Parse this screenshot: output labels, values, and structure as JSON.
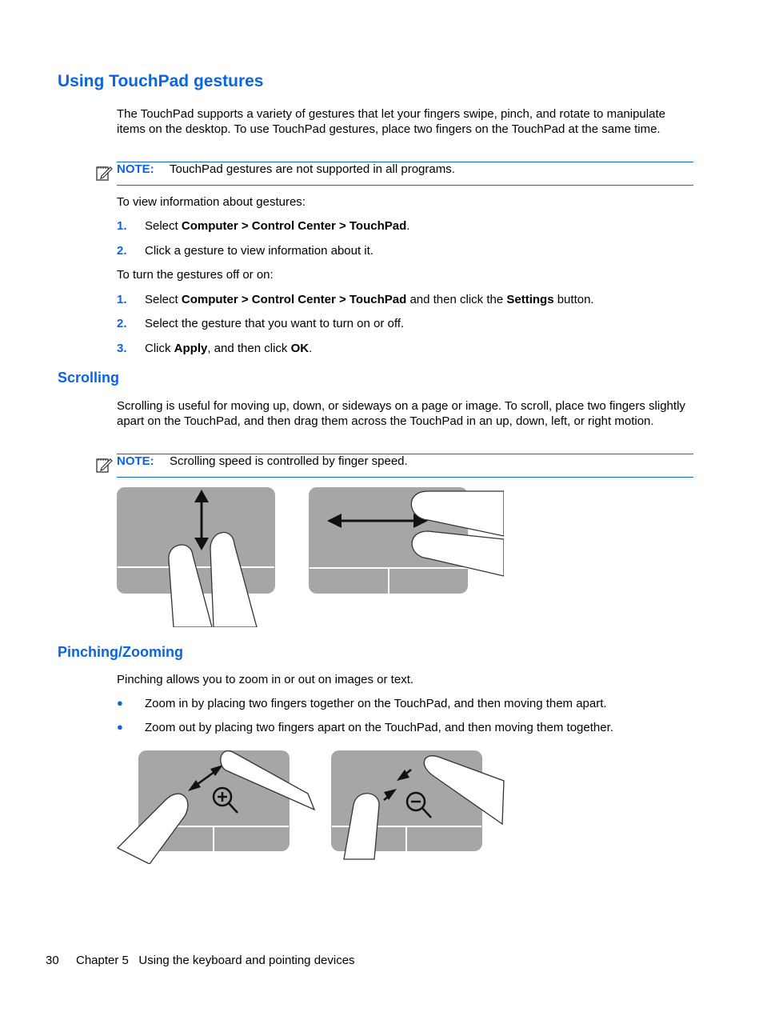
{
  "section": {
    "title": "Using TouchPad gestures",
    "intro": "The TouchPad supports a variety of gestures that let your fingers swipe, pinch, and rotate to manipulate items on the desktop. To use TouchPad gestures, place two fingers on the TouchPad at the same time.",
    "note1": {
      "label": "NOTE:",
      "text": "TouchPad gestures are not supported in all programs."
    },
    "view_info_intro": "To view information about gestures:",
    "view_steps": [
      {
        "num": "1.",
        "pre": "Select ",
        "bold": "Computer > Control Center > TouchPad",
        "post": "."
      },
      {
        "num": "2.",
        "text": "Click a gesture to view information about it."
      }
    ],
    "toggle_intro": "To turn the gestures off or on:",
    "toggle_steps": [
      {
        "num": "1.",
        "pre": "Select ",
        "bold": "Computer > Control Center > TouchPad",
        "mid": " and then click the ",
        "bold2": "Settings",
        "post": " button."
      },
      {
        "num": "2.",
        "text": "Select the gesture that you want to turn on or off."
      },
      {
        "num": "3.",
        "pre": "Click ",
        "bold": "Apply",
        "mid": ", and then click ",
        "bold2": "OK",
        "post": "."
      }
    ]
  },
  "scrolling": {
    "title": "Scrolling",
    "text": "Scrolling is useful for moving up, down, or sideways on a page or image. To scroll, place two fingers slightly apart on the TouchPad, and then drag them across the TouchPad in an up, down, left, or right motion.",
    "note": {
      "label": "NOTE:",
      "text": "Scrolling speed is controlled by finger speed."
    },
    "figures": [
      "vertical-scroll-illustration",
      "horizontal-scroll-illustration"
    ]
  },
  "pinching": {
    "title": "Pinching/Zooming",
    "text": "Pinching allows you to zoom in or out on images or text.",
    "bullets": [
      "Zoom in by placing two fingers together on the TouchPad, and then moving them apart.",
      "Zoom out by placing two fingers apart on the TouchPad, and then moving them together."
    ],
    "figures": [
      "zoom-in-illustration",
      "zoom-out-illustration"
    ]
  },
  "footer": {
    "page": "30",
    "chapter": "Chapter 5   Using the keyboard and pointing devices"
  },
  "colors": {
    "accent": "#0a64e6",
    "pad": "#a6a6a6"
  }
}
